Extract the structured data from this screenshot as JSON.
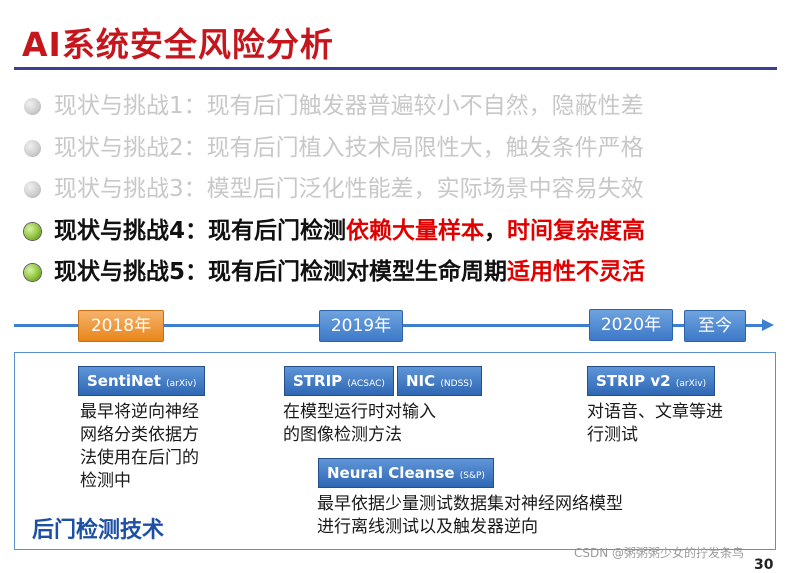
{
  "slide": {
    "title": "AI系统安全风险分析",
    "page_number": "30"
  },
  "bullets": [
    {
      "parts": [
        "现状与挑战1：现有后门触发器普遍较小不自然，隐蔽性差",
        ""
      ]
    },
    {
      "parts": [
        "现状与挑战2：现有后门植入技术局限性大，触发条件严格",
        ""
      ]
    },
    {
      "parts": [
        "现状与挑战3：模型后门泛化性能差，实际场景中容易失效",
        ""
      ]
    },
    {
      "parts": [
        "现状与挑战4：现有后门检测",
        "依赖大量样本",
        "，",
        "时间复杂度高"
      ]
    },
    {
      "parts": [
        "现状与挑战5：现有后门检测对模型生命周期",
        "适用性不灵活"
      ]
    }
  ],
  "timeline": {
    "years": [
      "2018年",
      "2019年",
      "2020年",
      "至今"
    ]
  },
  "methods": [
    {
      "name": "SentiNet",
      "venue": "(arXiv)",
      "desc_lines": [
        "最早将逆向神经",
        "网络分类依据方",
        "法使用在后门的",
        "检测中"
      ]
    },
    {
      "name": "STRIP",
      "venue": "(ACSAC)",
      "desc_lines": [
        "在模型运行时对输入",
        "的图像检测方法"
      ]
    },
    {
      "name": "NIC",
      "venue": "(NDSS)",
      "desc_lines": []
    },
    {
      "name": "STRIP v2",
      "venue": "(arXiv)",
      "desc_lines": [
        "对语音、文章等进",
        "行测试"
      ]
    },
    {
      "name": "Neural Cleanse",
      "venue": "(S&P)",
      "desc_lines": [
        "最早依据少量测试数据集对神经网络模型",
        "进行离线测试以及触发器逆向"
      ]
    }
  ],
  "panel": {
    "label": "后门检测技术"
  },
  "watermark": "CSDN @粥粥粥少女的拧发条鸟",
  "colors": {
    "title": "#c4161c",
    "highlight": "#e00000",
    "accent_blue": "#3d7fcf",
    "year_2018": "#e8861a"
  }
}
